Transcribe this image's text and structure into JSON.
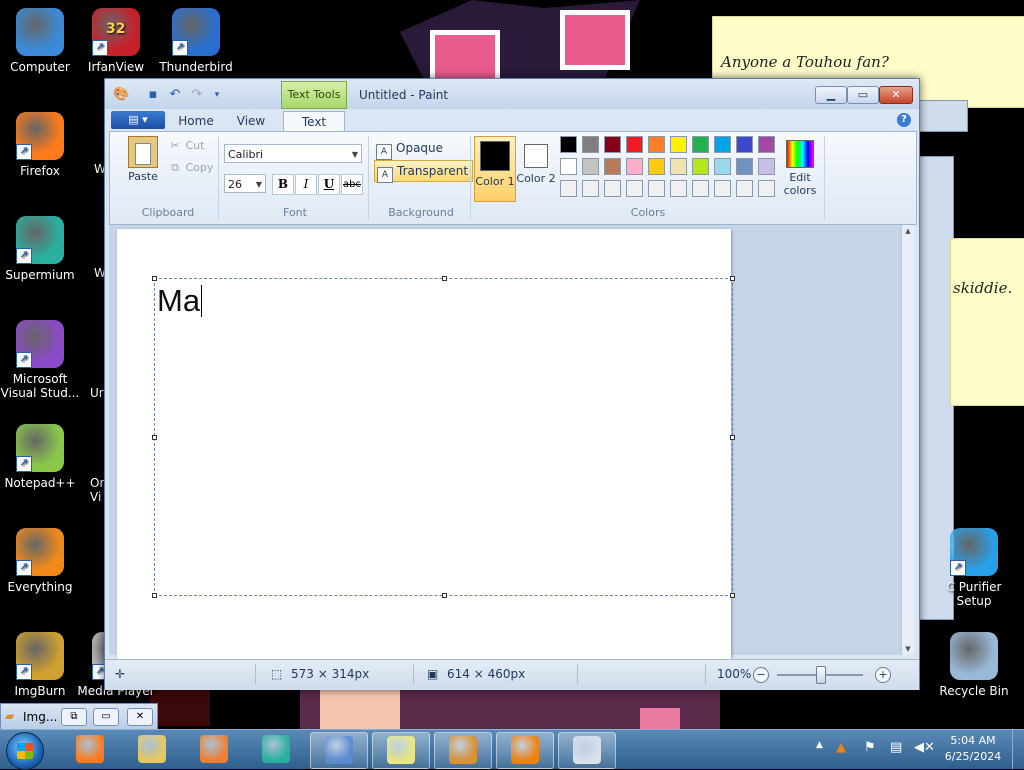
{
  "desktop": {
    "icons": [
      {
        "label": "Computer",
        "name": "computer-icon",
        "color": "#3a8ad8"
      },
      {
        "label": "IrfanView",
        "name": "irfanview-icon",
        "color": "#c8202a",
        "badge": "32"
      },
      {
        "label": "Thunderbird",
        "name": "thunderbird-icon",
        "color": "#2a6fd0"
      },
      {
        "label": "Firefox",
        "name": "firefox-icon",
        "color": "#ff7a1a"
      },
      {
        "label": "Supermium",
        "name": "supermium-icon",
        "color": "#2ab0a0"
      },
      {
        "label": "Microsoft Visual Stud...",
        "name": "visual-studio-icon",
        "color": "#8a4ac8"
      },
      {
        "label": "Notepad++",
        "name": "notepadpp-icon",
        "color": "#8ac84a"
      },
      {
        "label": "Everything",
        "name": "everything-icon",
        "color": "#f28a1a"
      },
      {
        "label": "ImgBurn",
        "name": "imgburn-icon",
        "color": "#d0a030"
      },
      {
        "label": "Media Player",
        "name": "media-player-icon",
        "color": "#c0c0c0"
      },
      {
        "label": "C Purifier Setup",
        "name": "purifier-setup-icon",
        "color": "#28a0e8"
      },
      {
        "label": "Recycle Bin",
        "name": "recycle-bin-icon",
        "color": "#9ab8d8"
      }
    ],
    "partial_labels": [
      "W",
      "W",
      "Ur",
      "Or",
      "Vi"
    ],
    "sticky_notes": [
      {
        "text": "Anyone a Touhou fan?"
      },
      {
        "text": "skiddie."
      }
    ]
  },
  "paint": {
    "title": "Untitled - Paint",
    "context_tab": "Text Tools",
    "tabs": [
      "Home",
      "View",
      "Text"
    ],
    "active_tab": "Text",
    "groups": {
      "clipboard": "Clipboard",
      "font": "Font",
      "background": "Background",
      "colors": "Colors"
    },
    "clipboard": {
      "paste": "Paste",
      "cut": "Cut",
      "copy": "Copy"
    },
    "font": {
      "family": "Calibri",
      "size": "26",
      "bold": "B",
      "italic": "I",
      "underline": "U",
      "strike": "abc"
    },
    "background": {
      "opaque": "Opaque",
      "transparent": "Transparent",
      "selected": "Transparent"
    },
    "color1_label": "Color 1",
    "color2_label": "Color 2",
    "color1": "#000000",
    "color2": "#ffffff",
    "edit_colors": "Edit colors",
    "palette": [
      "#000000",
      "#7f7f7f",
      "#880015",
      "#ed1c24",
      "#ff7f27",
      "#fff200",
      "#22b14c",
      "#00a2e8",
      "#3f48cc",
      "#a349a4",
      "#ffffff",
      "#c3c3c3",
      "#b97a57",
      "#ffaec9",
      "#ffc90e",
      "#efe4b0",
      "#b5e61d",
      "#99d9ea",
      "#7092be",
      "#c8bfe7",
      "#f0f0f0",
      "#f0f0f0",
      "#f0f0f0",
      "#f0f0f0",
      "#f0f0f0",
      "#f0f0f0",
      "#f0f0f0",
      "#f0f0f0",
      "#f0f0f0",
      "#f0f0f0"
    ],
    "canvas_text": "Ma",
    "status": {
      "selection_size": "573 × 314px",
      "image_size": "614 × 460px",
      "zoom": "100%"
    }
  },
  "minimized_window": {
    "title": "Img..."
  },
  "taskbar": {
    "apps": [
      {
        "name": "taskbar-firefox",
        "color": "#ff7a1a"
      },
      {
        "name": "taskbar-explorer",
        "color": "#e8c860"
      },
      {
        "name": "taskbar-media",
        "color": "#f08030"
      },
      {
        "name": "taskbar-supermium",
        "color": "#2ab0a0"
      },
      {
        "name": "taskbar-remote",
        "color": "#5a8ad0"
      },
      {
        "name": "taskbar-sticky-notes",
        "color": "#e8e880"
      },
      {
        "name": "taskbar-imgburn",
        "color": "#d89030"
      },
      {
        "name": "taskbar-vlc",
        "color": "#f08010"
      },
      {
        "name": "taskbar-paint",
        "color": "#d8e0ec"
      }
    ],
    "time": "5:04 AM",
    "date": "6/25/2024"
  }
}
